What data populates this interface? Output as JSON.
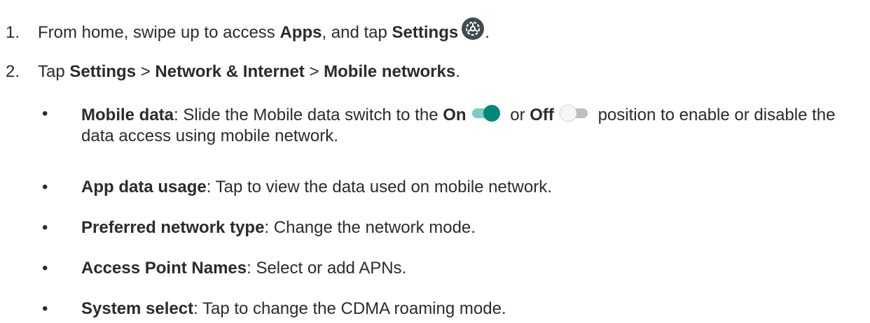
{
  "steps": [
    {
      "num": "1.",
      "t1": "From home, swipe up to access ",
      "b1": "Apps",
      "t2": ", and tap ",
      "b2": "Settings",
      "icon": "settings-gear-icon",
      "t3": "."
    },
    {
      "num": "2.",
      "t1": "Tap ",
      "b1": "Settings",
      "sep1": " > ",
      "b2": "Network & Internet",
      "sep2": " > ",
      "b3": "Mobile networks",
      "t2": "."
    }
  ],
  "bullet_char": "•",
  "bullets": {
    "mobile_data": {
      "label": "Mobile data",
      "t1": ": Slide the Mobile data switch to the ",
      "on": "On",
      "t2": " or ",
      "off": "Off",
      "t3": " position to enable or disable the data access using mobile network."
    },
    "app_data_usage": {
      "label": "App data usage",
      "text": ": Tap to view the data used on mobile network."
    },
    "preferred_network": {
      "label": "Preferred network type",
      "text": ": Change the network mode."
    },
    "apn": {
      "label": "Access Point Names",
      "text": ": Select or add APNs."
    },
    "system_select": {
      "label": "System select",
      "text": ": Tap to change the CDMA roaming mode."
    }
  },
  "colors": {
    "text": "#2b2b2b",
    "icon_bg": "#3f4a50",
    "toggle_on_thumb": "#00897b",
    "toggle_on_track": "#80cbc4",
    "toggle_off_thumb": "#f5f5f5",
    "toggle_off_track": "#bdbdbd"
  }
}
